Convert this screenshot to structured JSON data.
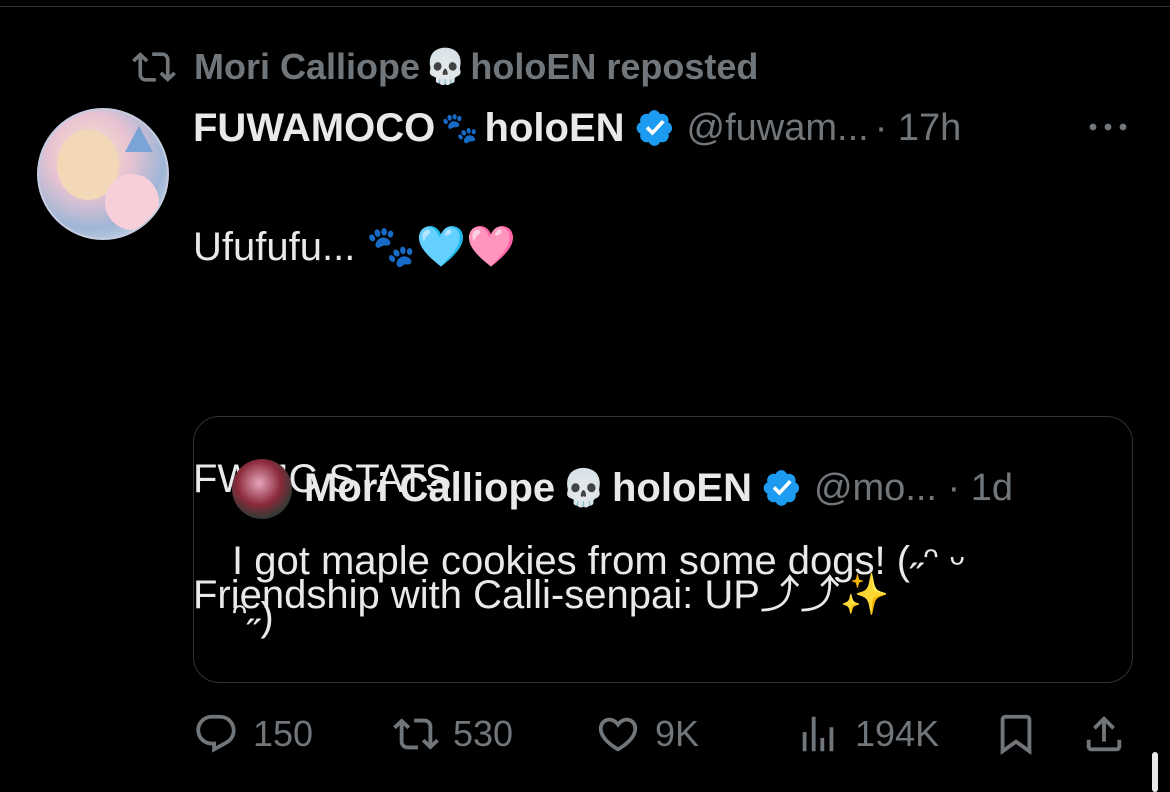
{
  "repost": {
    "name": "Mori Calliope",
    "emoji": "💀",
    "suffix": "holoEN reposted"
  },
  "tweet": {
    "author_name": "FUWAMOCO",
    "author_emoji": "🐾",
    "author_suffix": "holoEN",
    "handle": "@fuwam...",
    "time": "· 17h",
    "text_lines": [
      "Ufufufu... 🐾🩵🩷",
      "",
      "FWMC STATS:",
      "Friendship with Calli-senpai: UP⤴︎⤴︎✨"
    ]
  },
  "quote": {
    "author_name": "Mori Calliope",
    "author_emoji": "💀",
    "author_suffix": "holoEN",
    "handle": "@mo... · 1d",
    "text_lines": [
      "I got maple cookies from some dogs! (˶ᵔ ᵕ",
      "ᵔ˶)"
    ]
  },
  "actions": {
    "replies": "150",
    "reposts": "530",
    "likes": "9K",
    "views": "194K"
  },
  "colors": {
    "background": "#000000",
    "text": "#e7e9ea",
    "muted": "#71767b",
    "verified": "#1d9bf0",
    "border": "#2f3336"
  },
  "icons": [
    "repost-icon",
    "verified-icon",
    "more-icon",
    "reply-icon",
    "like-icon",
    "views-icon",
    "bookmark-icon",
    "share-icon"
  ]
}
